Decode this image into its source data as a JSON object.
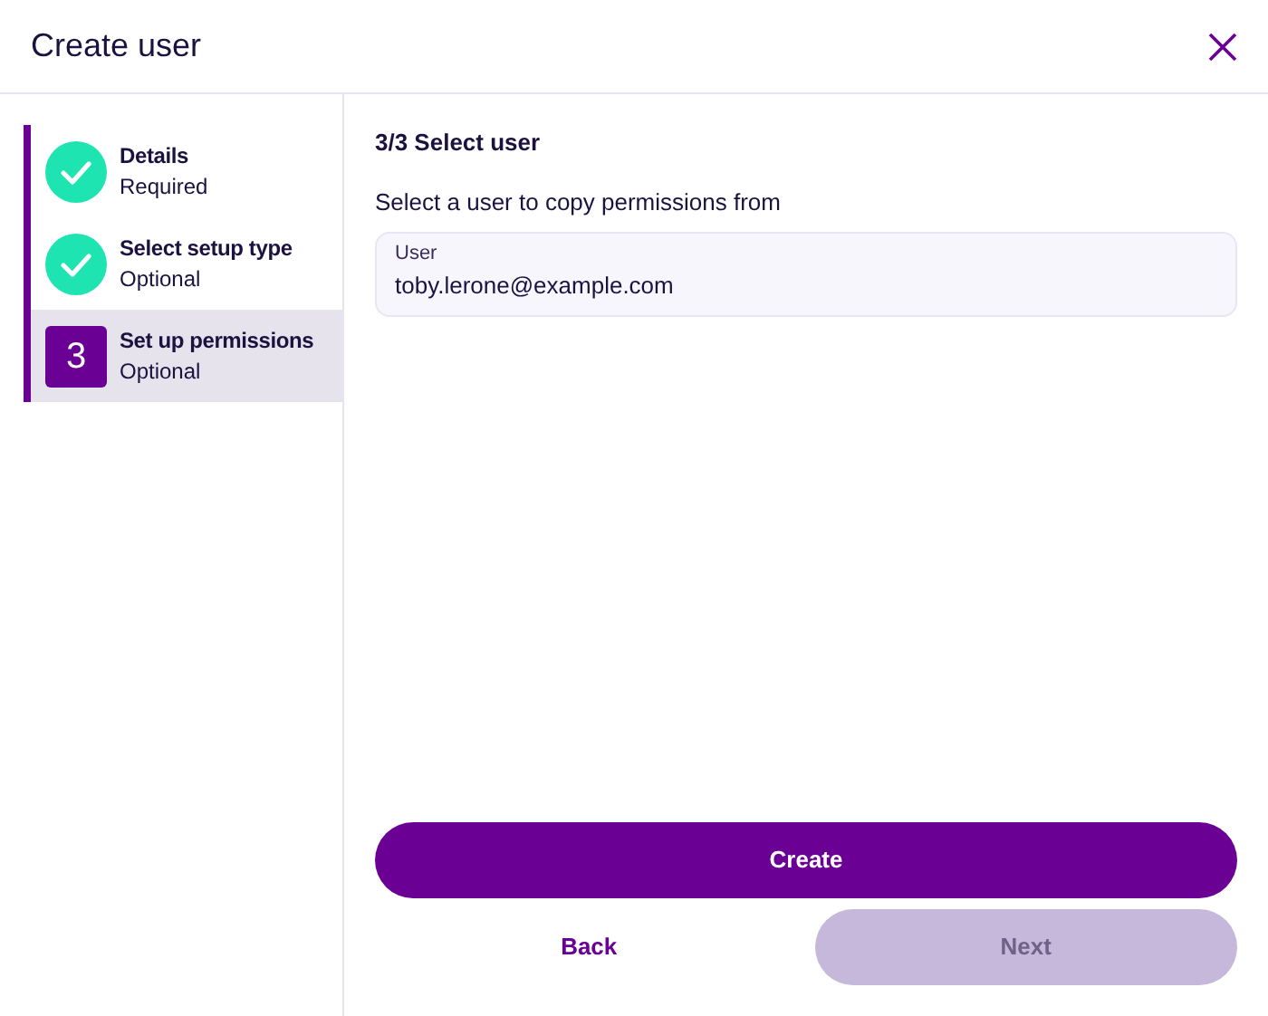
{
  "window": {
    "title": "Create user"
  },
  "steps": [
    {
      "kind": "done",
      "title": "Details",
      "subtitle": "Required",
      "selected": false
    },
    {
      "kind": "done",
      "title": "Select setup type",
      "subtitle": "Optional",
      "selected": false
    },
    {
      "kind": "current",
      "marker": "3",
      "title": "Set up permissions",
      "subtitle": "Optional",
      "selected": true
    }
  ],
  "panel": {
    "heading": "3/3 Select user",
    "instruction": "Select a user to copy permissions from",
    "field": {
      "label": "User",
      "value": "toby.lerone@example.com"
    }
  },
  "buttons": [
    {
      "kind": "primary",
      "label": "Create"
    },
    {
      "kind": "link",
      "label": "Back"
    },
    {
      "kind": "primary",
      "label": "Next",
      "disabled": true
    }
  ]
}
